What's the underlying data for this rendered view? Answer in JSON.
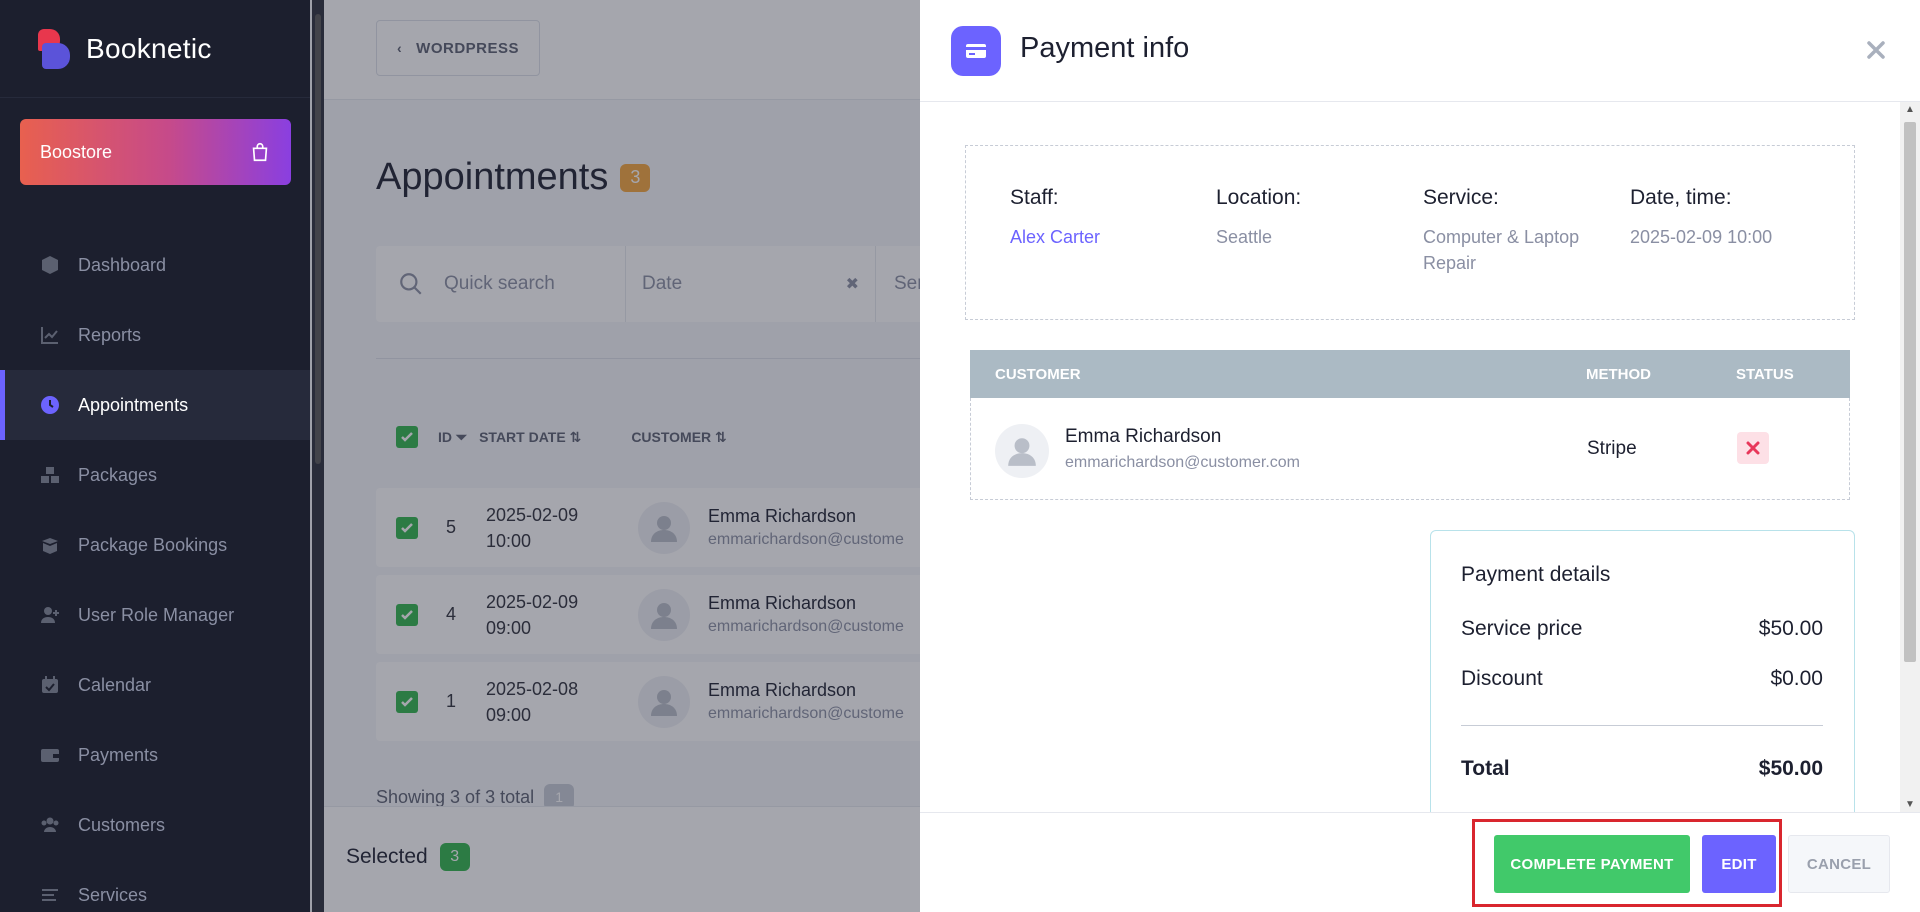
{
  "sidebar": {
    "logo": "Booknetic",
    "boostore": "Boostore",
    "items": [
      {
        "label": "Dashboard",
        "icon": "cube-icon"
      },
      {
        "label": "Reports",
        "icon": "chart-icon"
      },
      {
        "label": "Appointments",
        "icon": "clock-icon",
        "active": true
      },
      {
        "label": "Packages",
        "icon": "boxes-icon"
      },
      {
        "label": "Package Bookings",
        "icon": "box-open-icon"
      },
      {
        "label": "User Role Manager",
        "icon": "user-plus-icon"
      },
      {
        "label": "Calendar",
        "icon": "calendar-icon"
      },
      {
        "label": "Payments",
        "icon": "wallet-icon"
      },
      {
        "label": "Customers",
        "icon": "users-icon"
      },
      {
        "label": "Services",
        "icon": "list-icon"
      }
    ]
  },
  "main": {
    "wordpress_label": "WORDPRESS",
    "title": "Appointments",
    "count": "3",
    "search_placeholder": "Quick search",
    "date_placeholder": "Date",
    "service_placeholder": "Ser",
    "headers": {
      "id": "ID",
      "start_date": "START DATE",
      "customer": "CUSTOMER"
    },
    "rows": [
      {
        "id": "5",
        "date": "2025-02-09",
        "time": "10:00",
        "name": "Emma Richardson",
        "email": "emmarichardson@custome"
      },
      {
        "id": "4",
        "date": "2025-02-09",
        "time": "09:00",
        "name": "Emma Richardson",
        "email": "emmarichardson@custome"
      },
      {
        "id": "1",
        "date": "2025-02-08",
        "time": "09:00",
        "name": "Emma Richardson",
        "email": "emmarichardson@custome"
      }
    ],
    "showing": "Showing 3 of 3 total",
    "page": "1",
    "selected_label": "Selected",
    "selected_count": "3"
  },
  "panel": {
    "title": "Payment info",
    "info": {
      "staff_label": "Staff:",
      "staff": "Alex Carter",
      "location_label": "Location:",
      "location": "Seattle",
      "service_label": "Service:",
      "service_line1": "Computer & Laptop",
      "service_line2": "Repair",
      "datetime_label": "Date, time:",
      "datetime": "2025-02-09 10:00"
    },
    "table": {
      "headers": {
        "customer": "CUSTOMER",
        "method": "METHOD",
        "status": "STATUS"
      },
      "name": "Emma Richardson",
      "email": "emmarichardson@customer.com",
      "method": "Stripe"
    },
    "details": {
      "title": "Payment details",
      "service_price_label": "Service price",
      "service_price": "$50.00",
      "discount_label": "Discount",
      "discount": "$0.00",
      "total_label": "Total",
      "total": "$50.00"
    },
    "buttons": {
      "complete": "COMPLETE PAYMENT",
      "edit": "EDIT",
      "cancel": "CANCEL"
    }
  },
  "colors": {
    "accent": "#6c63ff",
    "success": "#41c96a",
    "sidebar_bg": "#1c1f2e",
    "highlight": "#d9262e"
  }
}
